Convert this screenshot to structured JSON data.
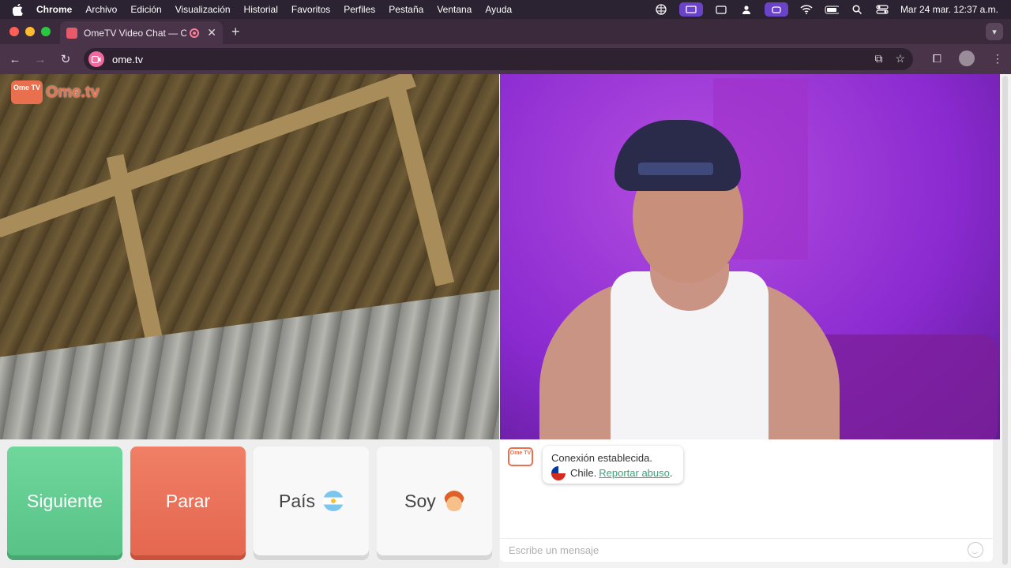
{
  "os_menubar": {
    "app_name": "Chrome",
    "menus": [
      "Archivo",
      "Edición",
      "Visualización",
      "Historial",
      "Favoritos",
      "Perfiles",
      "Pestaña",
      "Ventana",
      "Ayuda"
    ],
    "clock": "Mar 24 mar.  12:37 a.m."
  },
  "browser": {
    "tab_title": "OmeTV Video Chat — Omegle",
    "url": "ome.tv"
  },
  "page": {
    "logo_badge": "Ome TV",
    "logo_text": "Ome.tv",
    "buttons": {
      "next": "Siguiente",
      "stop": "Parar",
      "country": "País",
      "me": "Soy"
    },
    "chat": {
      "bot_badge": "Ome TV",
      "status_message": "Conexión establecida.",
      "country_text": "Chile.",
      "report_link": "Reportar abuso",
      "trailing_period": ".",
      "input_placeholder": "Escribe un mensaje"
    }
  }
}
